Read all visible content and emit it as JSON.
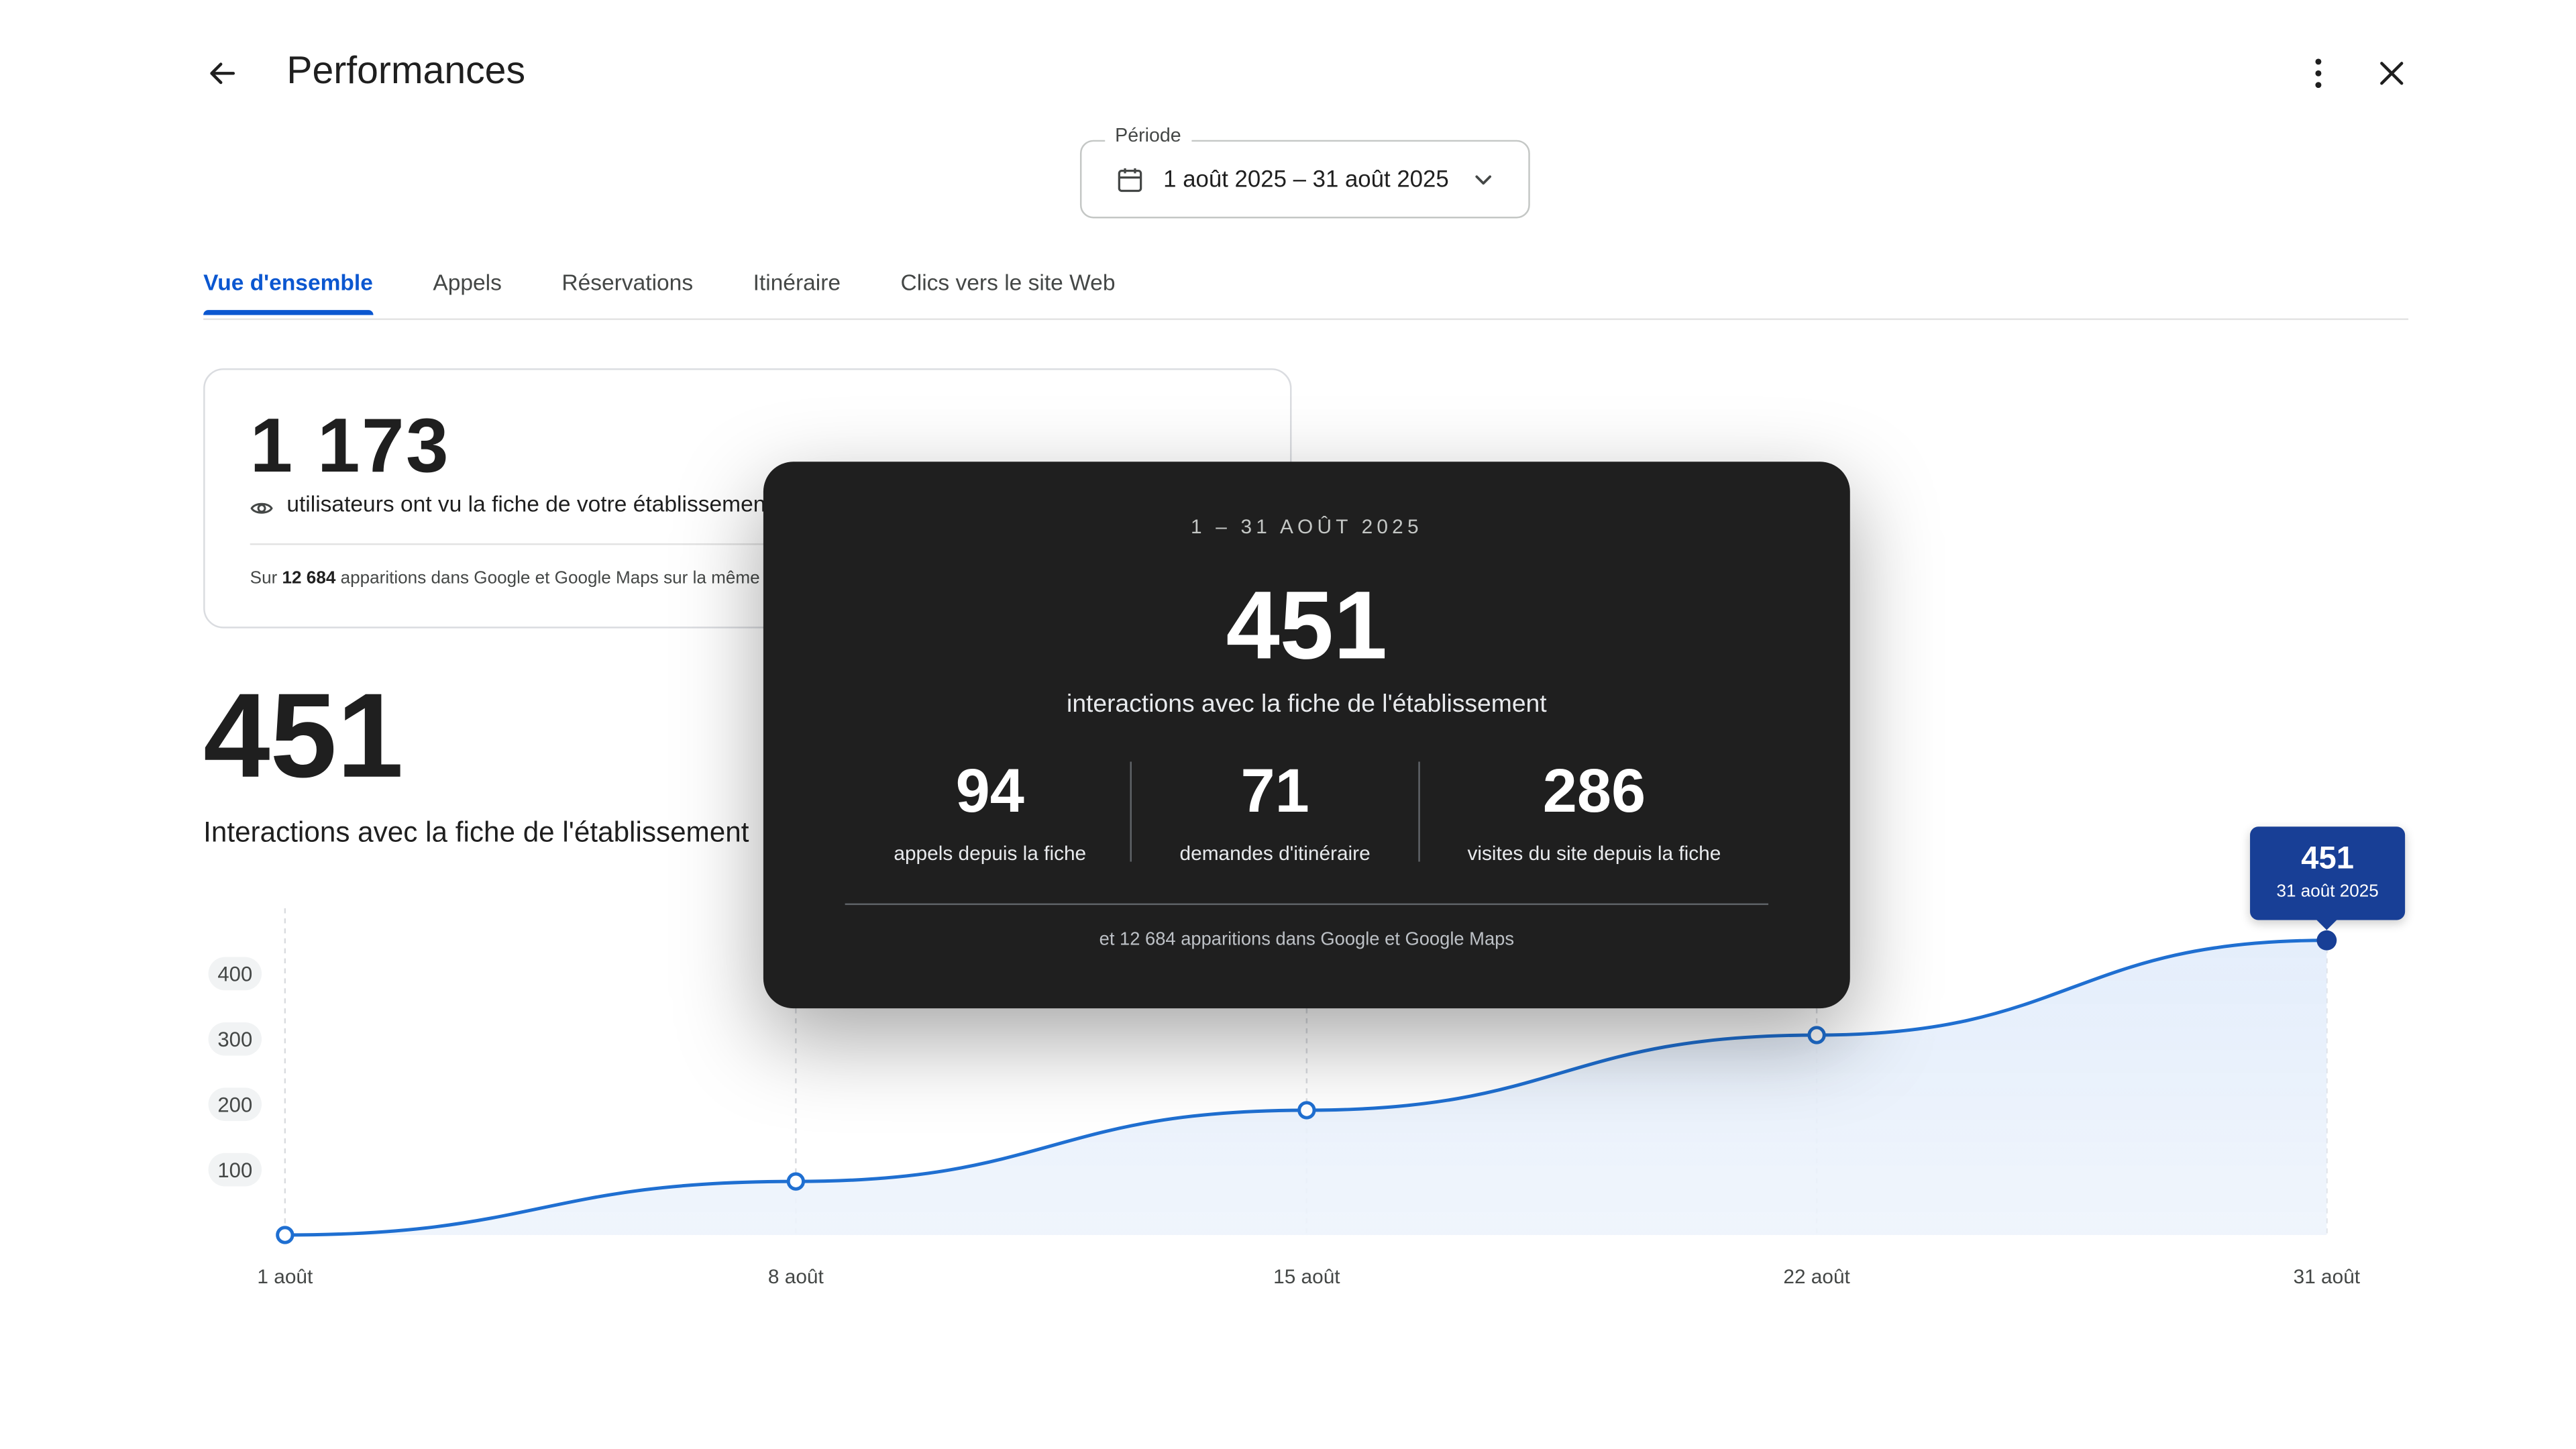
{
  "header": {
    "title": "Performances",
    "back_icon": "arrow-left-icon",
    "more_icon": "more-vert-icon",
    "close_icon": "close-icon"
  },
  "period": {
    "label": "Période",
    "value": "1 août 2025 – 31 août 2025"
  },
  "tabs": [
    {
      "label": "Vue d'ensemble",
      "active": true
    },
    {
      "label": "Appels",
      "active": false
    },
    {
      "label": "Réservations",
      "active": false
    },
    {
      "label": "Itinéraire",
      "active": false
    },
    {
      "label": "Clics vers le site Web",
      "active": false
    }
  ],
  "views_card": {
    "number": "1 173",
    "text": "utilisateurs ont vu la fiche de votre établissement",
    "sub_prefix": "Sur",
    "sub_bold": "12 684",
    "sub_suffix": "apparitions dans Google et Google Maps sur la même période."
  },
  "interactions": {
    "number": "451",
    "label": "Interactions avec la fiche de l'établissement"
  },
  "panel": {
    "date": "1 – 31 AOÛT 2025",
    "big": "451",
    "label": "interactions avec la fiche de l'établissement",
    "stats": [
      {
        "value": "94",
        "label": "appels depuis la fiche"
      },
      {
        "value": "71",
        "label": "demandes d'itinéraire"
      },
      {
        "value": "286",
        "label": "visites du site depuis la fiche"
      }
    ],
    "footer": "et 12 684 apparitions dans Google et Google Maps"
  },
  "callout": {
    "value": "451",
    "date": "31 août 2025"
  },
  "colors": {
    "accent": "#0b57d0",
    "line": "#1f6fd1",
    "callout_bg": "#183f96",
    "panel_bg": "#1f1f1f"
  },
  "chart_data": {
    "type": "area",
    "x": [
      "1 août",
      "8 août",
      "15 août",
      "22 août",
      "31 août"
    ],
    "values": [
      0,
      82,
      191,
      306,
      451
    ],
    "yticks": [
      100,
      200,
      300,
      400
    ],
    "ylim": [
      0,
      500
    ],
    "grid": "vertical dashed",
    "highlight_index": 4
  }
}
